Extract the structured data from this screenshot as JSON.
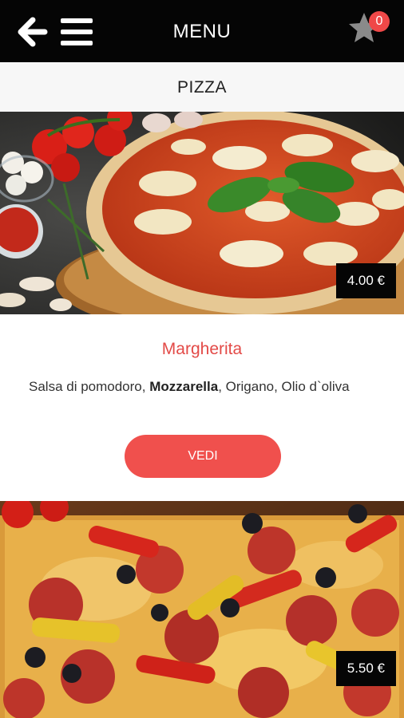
{
  "header": {
    "title": "MENU",
    "cart_count": "0"
  },
  "section": {
    "title": "PIZZA"
  },
  "items": [
    {
      "price": "4.00 €",
      "name": "Margherita",
      "desc_before": "Salsa di pomodoro, ",
      "desc_bold": "Mozzarella",
      "desc_after": ", Origano, Olio d`oliva",
      "button_label": "VEDI"
    },
    {
      "price": "5.50 €"
    }
  ],
  "colors": {
    "topbar": "#050505",
    "accent": "#f0504d",
    "name_text": "#e34a47",
    "badge": "#ef4848"
  },
  "icons": {
    "back": "back-arrow-icon",
    "menu": "hamburger-menu-icon",
    "favorites": "star-icon"
  }
}
